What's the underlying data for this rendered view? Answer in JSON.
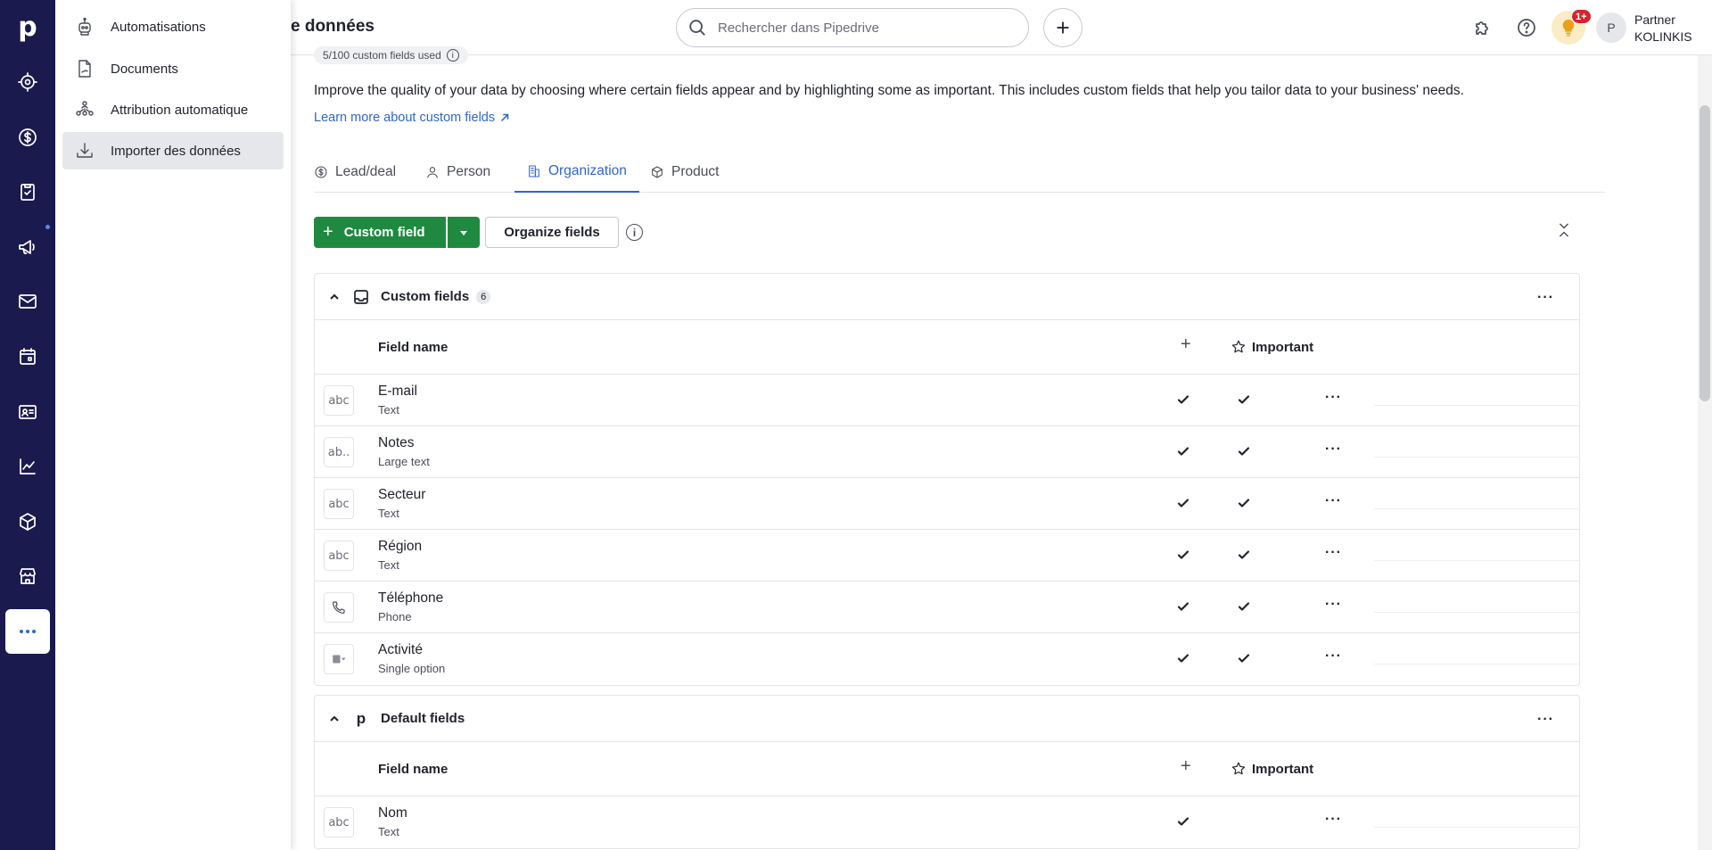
{
  "app": {
    "logo": "p",
    "page_title": "e données"
  },
  "rail": {
    "items": [
      {
        "icon": "target-icon"
      },
      {
        "icon": "dollar-icon"
      },
      {
        "icon": "clipboard-check-icon"
      },
      {
        "icon": "megaphone-icon"
      },
      {
        "icon": "mail-icon"
      },
      {
        "icon": "calendar-icon"
      },
      {
        "icon": "contact-card-icon"
      },
      {
        "icon": "chart-icon"
      },
      {
        "icon": "box-icon"
      },
      {
        "icon": "store-icon"
      },
      {
        "icon": "more-icon",
        "active": true
      }
    ]
  },
  "flyout": {
    "items": [
      {
        "label": "Automatisations",
        "icon": "robot-icon"
      },
      {
        "label": "Documents",
        "icon": "document-icon"
      },
      {
        "label": "Attribution automatique",
        "icon": "assignment-icon"
      },
      {
        "label": "Importer des données",
        "icon": "import-icon",
        "active": true
      }
    ]
  },
  "topbar": {
    "search_placeholder": "Rechercher dans Pipedrive",
    "notification_badge": "1+",
    "avatar_initial": "P",
    "user_line1": "Partner",
    "user_line2": "KOLINKIS"
  },
  "content": {
    "usage_text": "5/100 custom fields used",
    "intro": "Improve the quality of your data by choosing where certain fields appear and by highlighting some as important. This includes custom fields that help you tailor data to your business' needs.",
    "learn_more": "Learn more about custom fields",
    "tabs": [
      {
        "label": "Lead/deal",
        "icon": "dollar-icon"
      },
      {
        "label": "Person",
        "icon": "person-icon"
      },
      {
        "label": "Organization",
        "icon": "building-icon",
        "active": true
      },
      {
        "label": "Product",
        "icon": "box-icon"
      }
    ],
    "toolbar": {
      "custom_field": "Custom field",
      "organize_fields": "Organize fields"
    },
    "custom_section": {
      "title": "Custom fields",
      "count": "6",
      "col_field_name": "Field name",
      "col_important": "Important",
      "rows": [
        {
          "name": "E-mail",
          "type": "Text",
          "icon_text": "abc"
        },
        {
          "name": "Notes",
          "type": "Large text",
          "icon_text": "ab.."
        },
        {
          "name": "Secteur",
          "type": "Text",
          "icon_text": "abc"
        },
        {
          "name": "Région",
          "type": "Text",
          "icon_text": "abc"
        },
        {
          "name": "Téléphone",
          "type": "Phone",
          "icon_text": ""
        },
        {
          "name": "Activité",
          "type": "Single option",
          "icon_text": ""
        }
      ]
    },
    "default_section": {
      "title": "Default fields",
      "col_field_name": "Field name",
      "col_important": "Important",
      "rows": [
        {
          "name": "Nom",
          "type": "Text",
          "icon_text": "abc"
        }
      ]
    }
  }
}
